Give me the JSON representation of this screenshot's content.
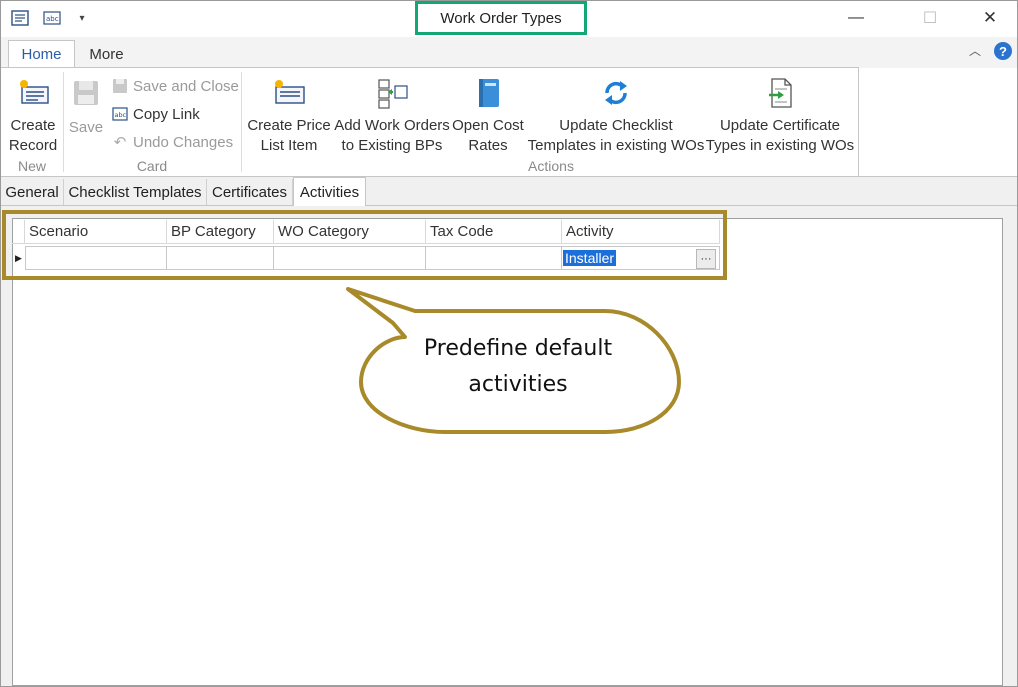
{
  "window": {
    "title": "Work Order Types",
    "minimize": "—",
    "maximize": "☐",
    "close": "✕"
  },
  "ribbon_tabs": [
    {
      "label": "Home",
      "active": true
    },
    {
      "label": "More",
      "active": false
    }
  ],
  "ribbon": {
    "new_group": {
      "label": "New",
      "create_record": "Create\nRecord"
    },
    "card_group": {
      "label": "Card",
      "save": "Save",
      "save_and_close": "Save and Close",
      "copy_link": "Copy Link",
      "undo_changes": "Undo Changes"
    },
    "actions_group": {
      "label": "Actions",
      "create_price_list_item_1": "Create Price",
      "create_price_list_item_2": "List Item",
      "add_work_orders_1": "Add Work Orders",
      "add_work_orders_2": "to Existing BPs",
      "open_cost_rates_1": "Open Cost",
      "open_cost_rates_2": "Rates",
      "update_checklist_1": "Update Checklist",
      "update_checklist_2": "Templates in existing WOs",
      "update_certificate_1": "Update Certificate",
      "update_certificate_2": "Types in existing WOs"
    }
  },
  "form_tabs": [
    {
      "label": "General",
      "active": false
    },
    {
      "label": "Checklist Templates",
      "active": false
    },
    {
      "label": "Certificates",
      "active": false
    },
    {
      "label": "Activities",
      "active": true
    }
  ],
  "grid": {
    "columns": [
      "Scenario",
      "BP Category",
      "WO Category",
      "Tax Code",
      "Activity"
    ],
    "rows": [
      {
        "scenario": "",
        "bp_category": "",
        "wo_category": "",
        "tax_code": "",
        "activity": "Installer"
      }
    ],
    "ellipsis": "···"
  },
  "callout": {
    "line1": "Predefine default",
    "line2": "activities"
  },
  "colors": {
    "title_highlight": "#12a874",
    "annotation": "#a88a2a",
    "selection": "#1c6ed8"
  }
}
